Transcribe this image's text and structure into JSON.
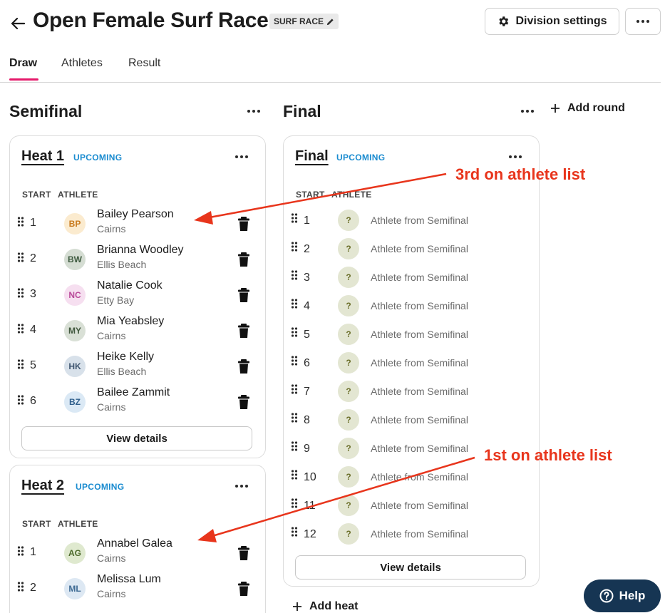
{
  "header": {
    "title": "Open Female Surf Race",
    "badge": "SURF RACE",
    "division_settings_label": "Division settings"
  },
  "tabs": [
    {
      "label": "Draw",
      "active": true
    },
    {
      "label": "Athletes",
      "active": false
    },
    {
      "label": "Result",
      "active": false
    }
  ],
  "rounds": {
    "semifinal": {
      "title": "Semifinal",
      "heats": [
        {
          "title": "Heat 1",
          "status": "UPCOMING",
          "start_col": "START",
          "athlete_col": "ATHLETE",
          "view_details": "View details",
          "athletes": [
            {
              "start": "1",
              "initials": "BP",
              "name": "Bailey Pearson",
              "club": "Cairns",
              "avatar_bg": "#fbebcf",
              "avatar_fg": "#c97a1d"
            },
            {
              "start": "2",
              "initials": "BW",
              "name": "Brianna Woodley",
              "club": "Ellis Beach",
              "avatar_bg": "#d5ddd3",
              "avatar_fg": "#3f5b40"
            },
            {
              "start": "3",
              "initials": "NC",
              "name": "Natalie Cook",
              "club": "Etty Bay",
              "avatar_bg": "#f6dff0",
              "avatar_fg": "#b94a9a"
            },
            {
              "start": "4",
              "initials": "MY",
              "name": "Mia Yeabsley",
              "club": "Cairns",
              "avatar_bg": "#d9e0d6",
              "avatar_fg": "#42593f"
            },
            {
              "start": "5",
              "initials": "HK",
              "name": "Heike Kelly",
              "club": "Ellis Beach",
              "avatar_bg": "#d8e1ea",
              "avatar_fg": "#3f5670"
            },
            {
              "start": "6",
              "initials": "BZ",
              "name": "Bailee Zammit",
              "club": "Cairns",
              "avatar_bg": "#dbe9f5",
              "avatar_fg": "#2f5f8c"
            }
          ]
        },
        {
          "title": "Heat 2",
          "status": "UPCOMING",
          "start_col": "START",
          "athlete_col": "ATHLETE",
          "athletes": [
            {
              "start": "1",
              "initials": "AG",
              "name": "Annabel Galea",
              "club": "Cairns",
              "avatar_bg": "#dfe9cf",
              "avatar_fg": "#4c6a2b"
            },
            {
              "start": "2",
              "initials": "ML",
              "name": "Melissa Lum",
              "club": "Cairns",
              "avatar_bg": "#dde8f3",
              "avatar_fg": "#3d6a93"
            }
          ]
        }
      ]
    },
    "final": {
      "title": "Final",
      "heat": {
        "title": "Final",
        "status": "UPCOMING",
        "start_col": "START",
        "athlete_col": "ATHLETE",
        "view_details": "View details",
        "placeholder_glyph": "?",
        "placeholder_bg": "#e3e6d2",
        "placeholder_fg": "#6b6f2a",
        "rows": [
          {
            "start": "1",
            "text": "Athlete from Semifinal"
          },
          {
            "start": "2",
            "text": "Athlete from Semifinal"
          },
          {
            "start": "3",
            "text": "Athlete from Semifinal"
          },
          {
            "start": "4",
            "text": "Athlete from Semifinal"
          },
          {
            "start": "5",
            "text": "Athlete from Semifinal"
          },
          {
            "start": "6",
            "text": "Athlete from Semifinal"
          },
          {
            "start": "7",
            "text": "Athlete from Semifinal"
          },
          {
            "start": "8",
            "text": "Athlete from Semifinal"
          },
          {
            "start": "9",
            "text": "Athlete from Semifinal"
          },
          {
            "start": "10",
            "text": "Athlete from Semifinal"
          },
          {
            "start": "11",
            "text": "Athlete from Semifinal"
          },
          {
            "start": "12",
            "text": "Athlete from Semifinal"
          }
        ]
      }
    }
  },
  "add_round_label": "Add round",
  "add_heat_label": "Add heat",
  "annotations": {
    "third": "3rd on athlete list",
    "first": "1st on athlete list",
    "color": "#e8351c"
  },
  "help_label": "Help",
  "colors": {
    "accent_pink": "#e5196a",
    "status_blue": "#1b8cd0",
    "help_navy": "#163553"
  }
}
